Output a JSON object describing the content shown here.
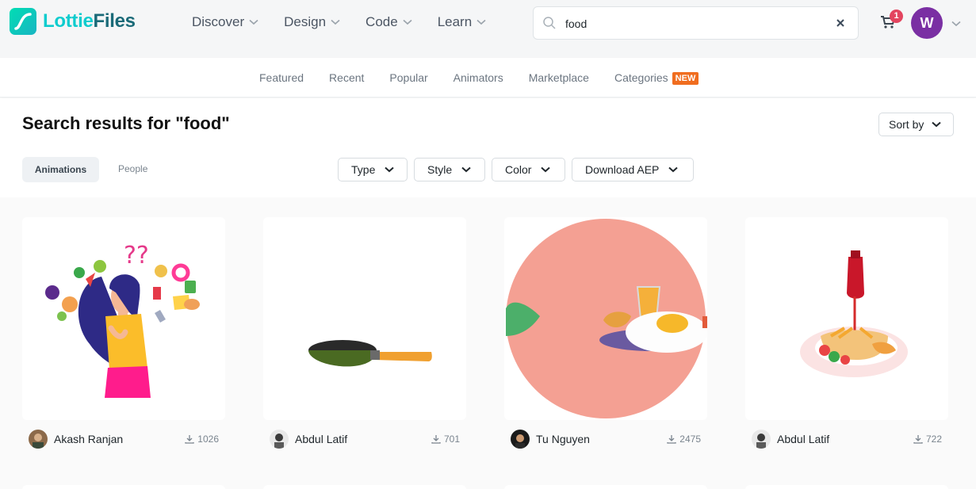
{
  "brand": {
    "name_part1": "Lottie",
    "name_part2": "Files"
  },
  "header": {
    "nav": [
      "Discover",
      "Design",
      "Code",
      "Learn"
    ],
    "search": {
      "value": "food",
      "placeholder": ""
    },
    "cart_count": "1",
    "user_initial": "W"
  },
  "subnav": {
    "items": [
      "Featured",
      "Recent",
      "Popular",
      "Animators",
      "Marketplace",
      "Categories"
    ],
    "new_badge": "NEW"
  },
  "results": {
    "title": "Search results for \"food\"",
    "sort_label": "Sort by",
    "tabs": [
      "Animations",
      "People"
    ],
    "filters": [
      "Type",
      "Style",
      "Color",
      "Download AEP"
    ]
  },
  "cards": [
    {
      "author": "Akash Ranjan",
      "downloads": "1026"
    },
    {
      "author": "Abdul Latif",
      "downloads": "701"
    },
    {
      "author": "Tu Nguyen",
      "downloads": "2475"
    },
    {
      "author": "Abdul Latif",
      "downloads": "722"
    }
  ],
  "colors": {
    "accent": "#0fccce",
    "brand_dark": "#1a6a78",
    "badge": "#f06d1f",
    "avatar": "#7a2fa3",
    "cart_badge": "#e3455f"
  }
}
